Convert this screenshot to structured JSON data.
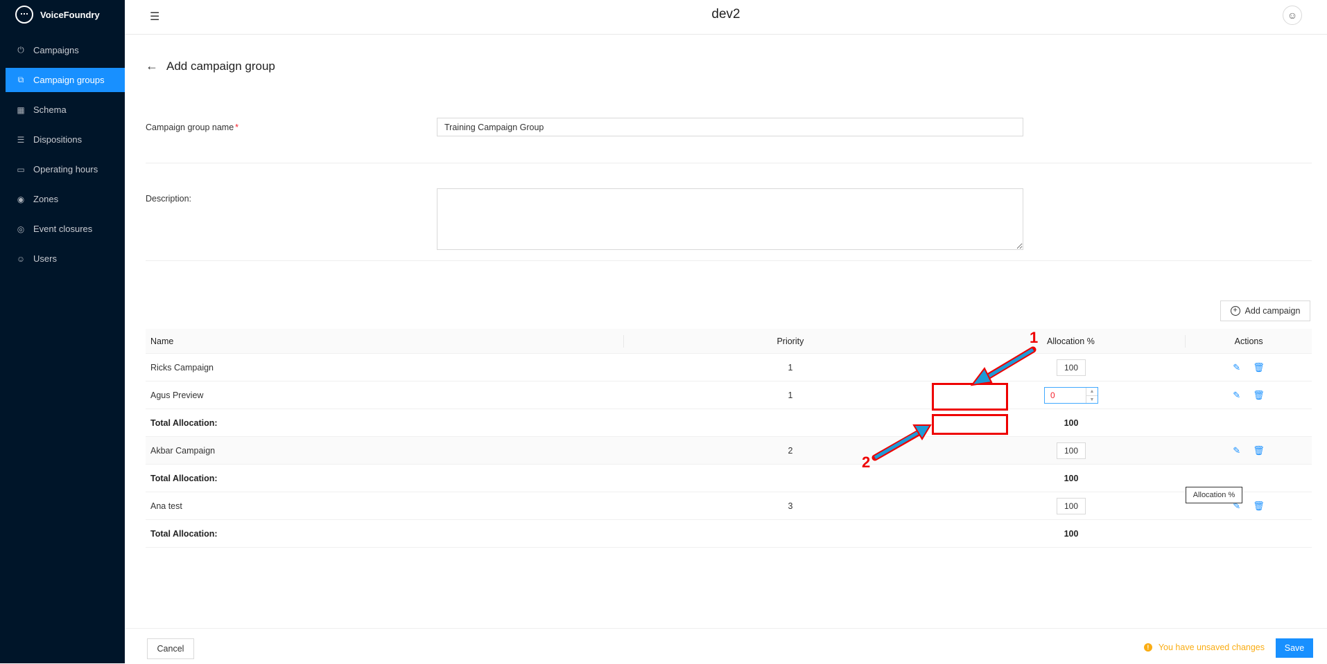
{
  "brand": {
    "name": "VoiceFoundry"
  },
  "sidebar": {
    "items": [
      {
        "label": "Campaigns",
        "icon": "power-icon"
      },
      {
        "label": "Campaign groups",
        "icon": "campaign-groups-icon",
        "active": true
      },
      {
        "label": "Schema",
        "icon": "table-icon"
      },
      {
        "label": "Dispositions",
        "icon": "list-icon"
      },
      {
        "label": "Operating hours",
        "icon": "calendar-icon"
      },
      {
        "label": "Zones",
        "icon": "location-pin-icon"
      },
      {
        "label": "Event closures",
        "icon": "target-icon"
      },
      {
        "label": "Users",
        "icon": "user-icon"
      }
    ]
  },
  "header": {
    "title": "dev2"
  },
  "page": {
    "title": "Add campaign group"
  },
  "form": {
    "name_label": "Campaign group name",
    "name_required_mark": "*",
    "name_value": "Training Campaign Group",
    "description_label": "Description:",
    "description_value": ""
  },
  "add_campaign_label": "Add campaign",
  "table": {
    "headers": {
      "name": "Name",
      "priority": "Priority",
      "allocation": "Allocation %",
      "actions": "Actions"
    },
    "rows": [
      {
        "name": "Ricks Campaign",
        "priority": "1",
        "allocation": "100"
      },
      {
        "name": "Agus Preview",
        "priority": "1",
        "allocation": "0"
      },
      {
        "total_label": "Total Allocation:",
        "total": "100"
      },
      {
        "name": "Akbar Campaign",
        "priority": "2",
        "allocation": "100"
      },
      {
        "total_label": "Total Allocation:",
        "total": "100"
      },
      {
        "name": "Ana test",
        "priority": "3",
        "allocation": "100"
      },
      {
        "total_label": "Total Allocation:",
        "total": "100"
      }
    ]
  },
  "tooltip": "Allocation %",
  "annotations": {
    "label_1": "1",
    "label_2": "2",
    "color": "#e00000"
  },
  "footer": {
    "cancel_label": "Cancel",
    "unsaved_text": "You have unsaved changes",
    "save_label": "Save"
  },
  "colors": {
    "sidebar_bg": "#001529",
    "primary": "#1890ff",
    "warning": "#faad14"
  }
}
